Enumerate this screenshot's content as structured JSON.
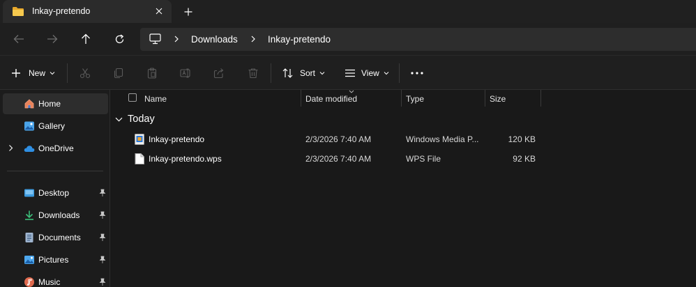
{
  "tab": {
    "title": "Inkay-pretendo"
  },
  "address": {
    "crumbs": [
      "Downloads",
      "Inkay-pretendo"
    ]
  },
  "commands": {
    "new": "New",
    "sort": "Sort",
    "view": "View"
  },
  "sidebar": {
    "items": [
      {
        "label": "Home",
        "icon": "home-icon"
      },
      {
        "label": "Gallery",
        "icon": "gallery-icon"
      },
      {
        "label": "OneDrive",
        "icon": "cloud-icon"
      },
      {
        "label": "Desktop",
        "icon": "desktop-icon"
      },
      {
        "label": "Downloads",
        "icon": "download-icon"
      },
      {
        "label": "Documents",
        "icon": "document-icon"
      },
      {
        "label": "Pictures",
        "icon": "pictures-icon"
      },
      {
        "label": "Music",
        "icon": "music-icon"
      }
    ]
  },
  "columns": {
    "name": "Name",
    "date": "Date modified",
    "type": "Type",
    "size": "Size"
  },
  "group": {
    "label": "Today"
  },
  "files": [
    {
      "name": "Inkay-pretendo",
      "date": "2/3/2026 7:40 AM",
      "type": "Windows Media P...",
      "size": "120 KB",
      "icon": "media-file-icon"
    },
    {
      "name": "Inkay-pretendo.wps",
      "date": "2/3/2026 7:40 AM",
      "type": "WPS File",
      "size": "92 KB",
      "icon": "generic-file-icon"
    }
  ],
  "colors": {
    "accent": "#0078d4",
    "folder": "#f1c34a",
    "background": "#191919"
  }
}
